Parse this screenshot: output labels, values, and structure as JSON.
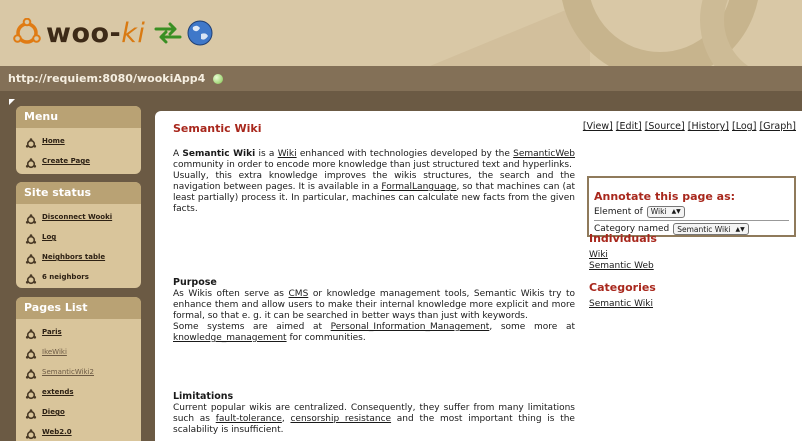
{
  "header": {
    "logo_prefix": "woo-",
    "logo_suffix": "ki"
  },
  "url_bar": {
    "url": "http://requiem:8080/wookiApp4"
  },
  "sidebar": {
    "menu": {
      "title": "Menu",
      "items": [
        "Home",
        "Create Page"
      ]
    },
    "site_status": {
      "title": "Site status",
      "items": [
        "Disconnect Wooki",
        "Log",
        "Neighbors table",
        "6 neighbors"
      ]
    },
    "pages_list": {
      "title": "Pages List",
      "items": [
        "Paris",
        "IkeWiki",
        "SemanticWiki2",
        "extends",
        "Diego",
        "Web2.0"
      ]
    }
  },
  "content": {
    "title": "Semantic Wiki",
    "actions": [
      "[View]",
      "[Edit]",
      "[Source]",
      "[History]",
      "[Log]",
      "[Graph]"
    ],
    "intro": {
      "t1": "A ",
      "b1": "Semantic Wiki",
      "t2": " is a ",
      "l1": "Wiki",
      "t3": " enhanced with technologies developed by the ",
      "l2": "SemanticWeb",
      "t4": " community in order to encode more knowledge than just structured text and hyperlinks.",
      "t5": "Usually, this extra knowledge improves the wikis structures, the search and the navigation between pages. It is available in a ",
      "l3": "FormalLanguage",
      "t6": ", so that machines can (at least partially) process it. In particular, machines can calculate new facts from the given facts."
    },
    "purpose": {
      "heading": "Purpose",
      "t1": "As Wikis often serve as ",
      "l1": "CMS",
      "t2": " or knowledge management tools, Semantic Wikis try to enhance them and allow users to make their internal knowledge more explicit and more formal, so that e. g. it can be searched in better ways than just with keywords.",
      "t3": "Some systems are aimed at ",
      "l2": "Personal_Information_Management",
      "t4": ", some more at ",
      "l3": "knowledge_management",
      "t5": " for communities."
    },
    "limitations": {
      "heading": "Limitations",
      "t1": "Current popular wikis are centralized. Consequently, they suffer from many limitations such as ",
      "l1": "fault-tolerance",
      "t2": ", ",
      "l2": "censorship resistance",
      "t3": " and the most important thing is the scalability is insufficient."
    }
  },
  "annotate": {
    "title": "Annotate this page as:",
    "element_label": "Element of",
    "element_value": "Wiki",
    "category_label": "Category named",
    "category_value": "Semantic Wiki"
  },
  "individuals": {
    "title": "Individuals",
    "items": [
      "Wiki",
      "Semantic Web"
    ]
  },
  "categories": {
    "title": "Categories",
    "items": [
      "Semantic Wiki"
    ]
  },
  "colors": {
    "accent_red": "#a8271c",
    "header_bg": "#d9c8a6",
    "sidebar_panel": "#d9c59b",
    "page_bg": "#6b5a44"
  },
  "icons": [
    "ubuntu-logo-icon",
    "swap-arrows-icon",
    "globe-icon",
    "status-dot-icon",
    "gear-bullet-icon"
  ]
}
